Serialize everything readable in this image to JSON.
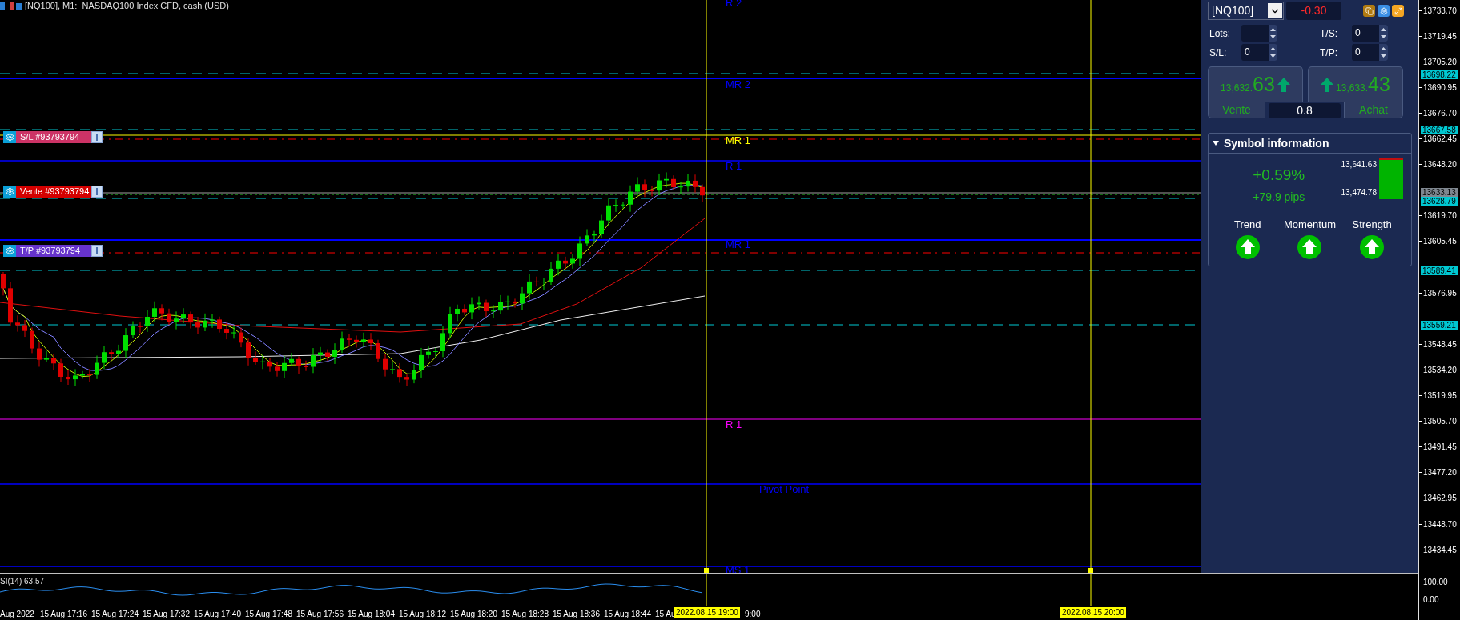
{
  "chart": {
    "title": "[NQ100], M1:  NASDAQ100 Index CFD, cash (USD)",
    "order_tags": [
      {
        "label": "S/L #93793794",
        "color": "#cc3366"
      },
      {
        "label": "Vente #93793794",
        "color": "#d40000"
      },
      {
        "label": "T/P #93793794",
        "color": "#6633cc"
      }
    ],
    "level_labels": [
      {
        "text": "R 2",
        "color": "#0000ff"
      },
      {
        "text": "MR 2",
        "color": "#0000ff"
      },
      {
        "text": "MR 1",
        "color": "#ffff00"
      },
      {
        "text": "R 1",
        "color": "#0000ff"
      },
      {
        "text": "MR 1",
        "color": "#0000ff"
      },
      {
        "text": "R 1",
        "color": "#ff00ff"
      },
      {
        "text": "Pivot Point",
        "color": "#0000ff"
      },
      {
        "text": "MS 1",
        "color": "#0000ff"
      }
    ],
    "indicator_label": "SI(14) 63.57"
  },
  "price_axis": {
    "ticks": [
      "13733.70",
      "13719.45",
      "13705.20",
      "13690.95",
      "13676.70",
      "13662.45",
      "13648.20",
      "13619.70",
      "13605.45",
      "13576.95",
      "13548.45",
      "13534.20",
      "13519.95",
      "13505.70",
      "13491.45",
      "13477.20",
      "13462.95",
      "13448.70",
      "13434.45"
    ],
    "tags": [
      {
        "value": "13698.22",
        "color": "#00c8d2"
      },
      {
        "value": "13667.58",
        "color": "#00c8d2"
      },
      {
        "value": "13633.13",
        "color": "#7f8790"
      },
      {
        "value": "13628.79",
        "color": "#00c8d2"
      },
      {
        "value": "13589.41",
        "color": "#00c8d2"
      },
      {
        "value": "13559.21",
        "color": "#00c8d2"
      }
    ]
  },
  "indicator_axis": {
    "ticks": [
      "100.00",
      "0.00"
    ]
  },
  "time_axis": {
    "labels": [
      "Aug 2022",
      "15 Aug 17:16",
      "15 Aug 17:24",
      "15 Aug 17:32",
      "15 Aug 17:40",
      "15 Aug 17:48",
      "15 Aug 17:56",
      "15 Aug 18:04",
      "15 Aug 18:12",
      "15 Aug 18:20",
      "15 Aug 18:28",
      "15 Aug 18:36",
      "15 Aug 18:44",
      "15 Au",
      "9:00"
    ],
    "cursor_labels": [
      "2022.08.15 19:00",
      "2022.08.15 20:00"
    ]
  },
  "trade_panel": {
    "symbol": "[NQ100]",
    "change": "-0.30",
    "fields": [
      {
        "label": "Lots:"
      },
      {
        "label": "T/S:",
        "value": "0"
      },
      {
        "label": "S/L:",
        "value": "0"
      },
      {
        "label": "T/P:",
        "value": "0"
      }
    ],
    "sell": {
      "price_small": "13,632.",
      "price_big": "63",
      "label": "Vente"
    },
    "buy": {
      "price_small": "13,633.",
      "price_big": "43",
      "label": "Achat"
    },
    "spread": "0.8",
    "symbol_info": {
      "title": "Symbol information",
      "expanded": true,
      "percent": "+0.59%",
      "pips": "+79.9 pips",
      "high": "13,641.63",
      "low": "13,474.78",
      "indicators": [
        {
          "label": "Trend",
          "kind": "up"
        },
        {
          "label": "Momentum",
          "kind": "up"
        },
        {
          "label": "Strength",
          "kind": "up"
        }
      ]
    }
  }
}
